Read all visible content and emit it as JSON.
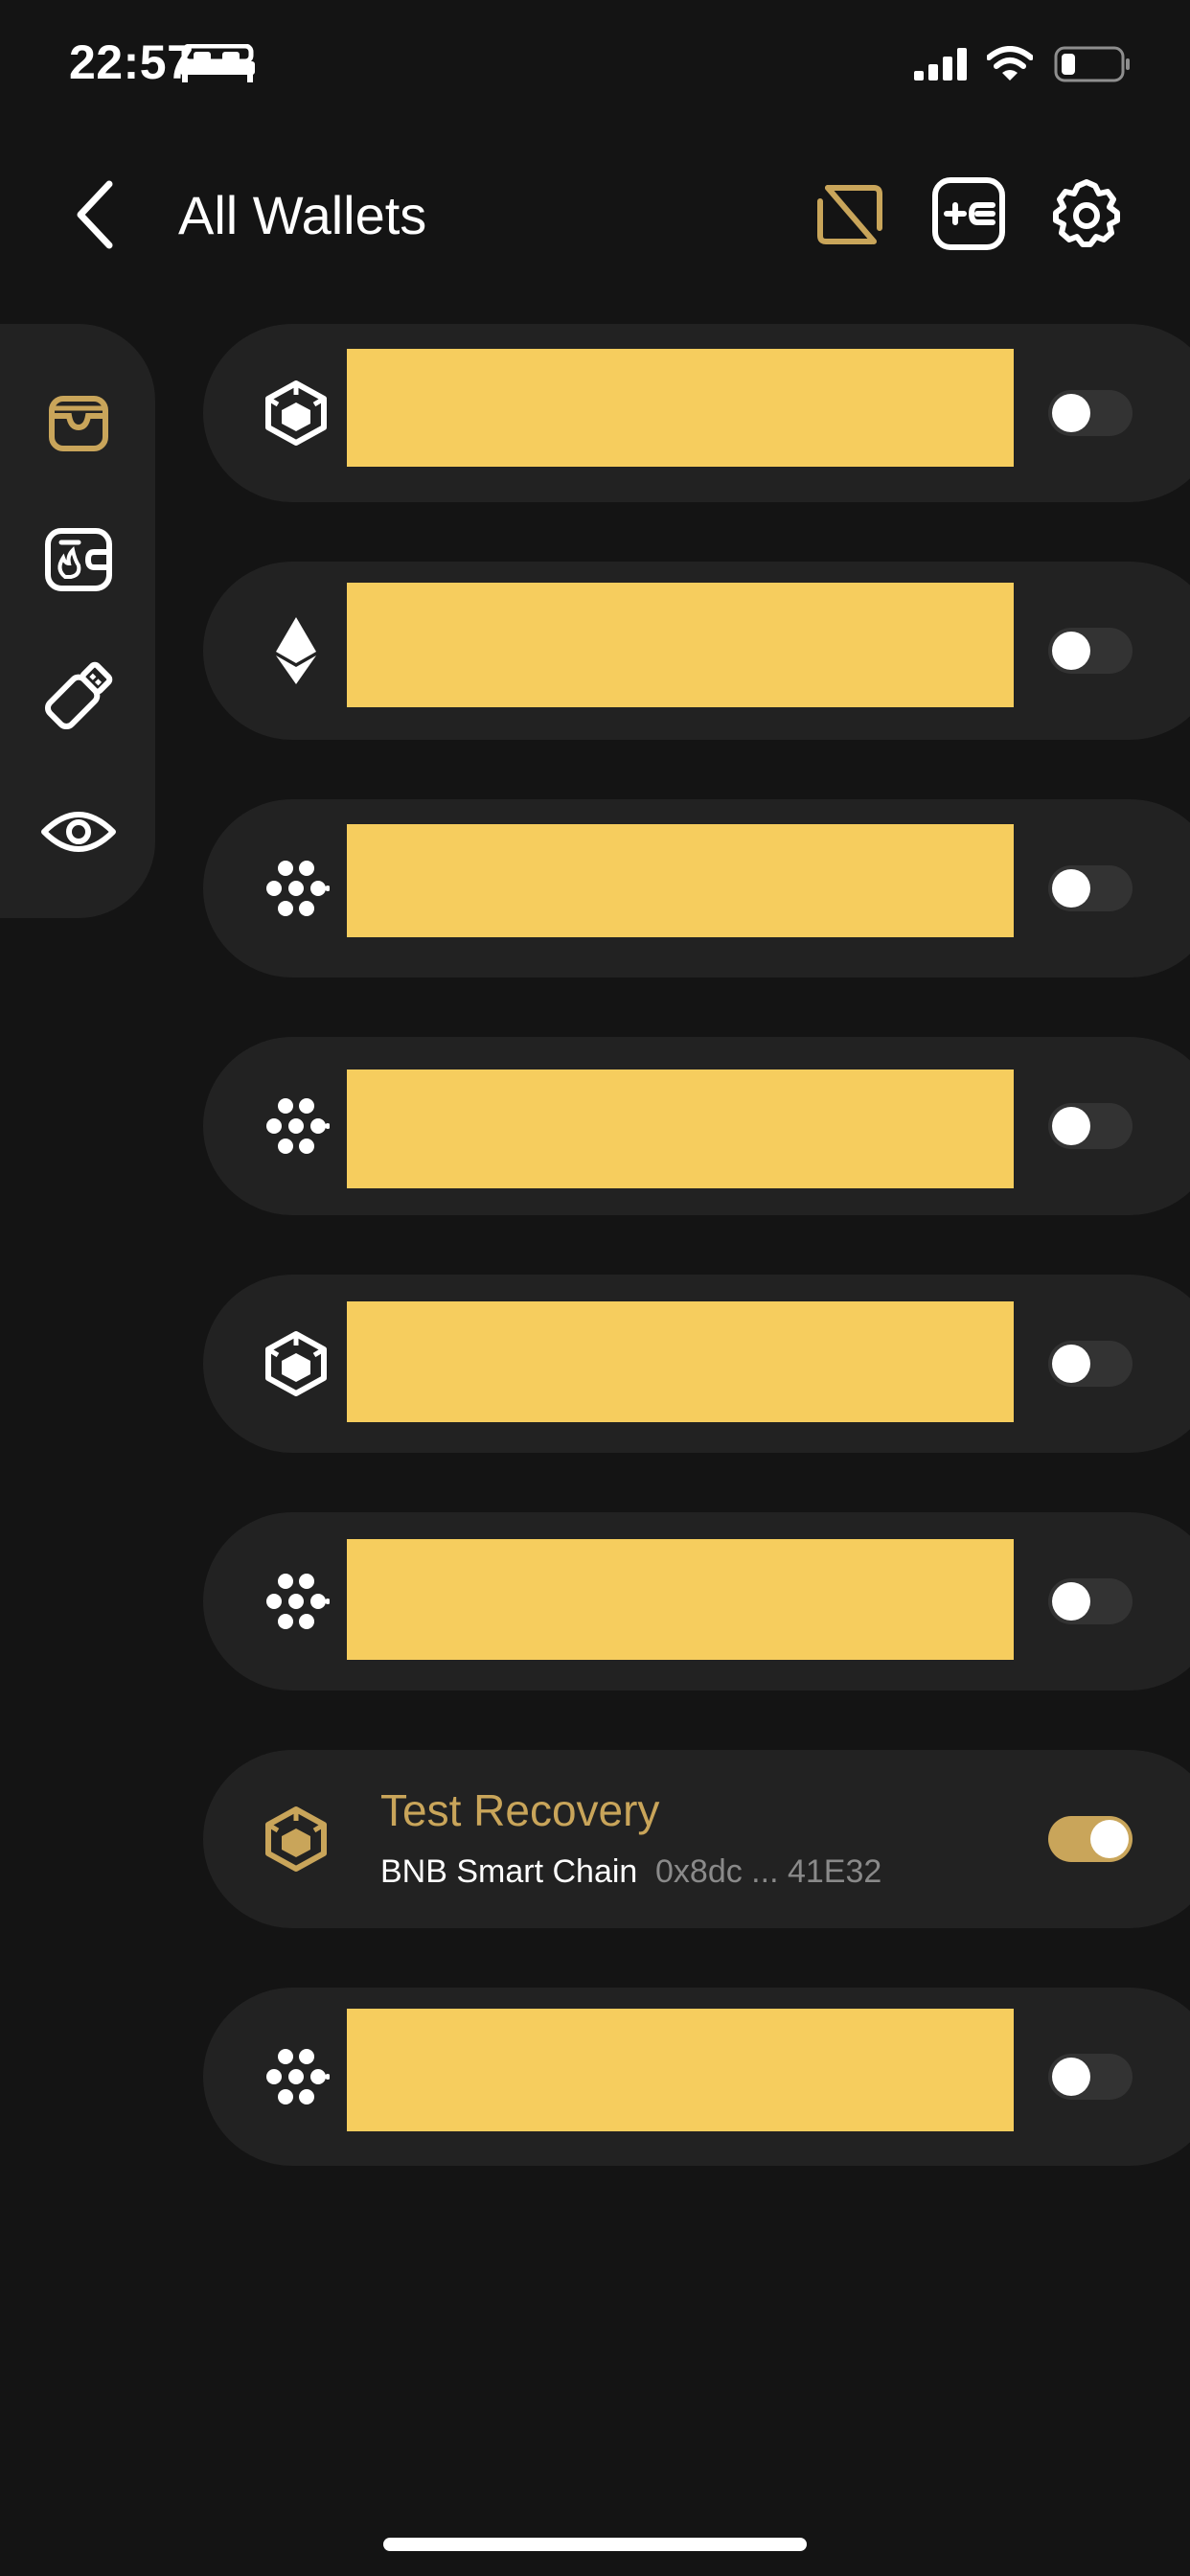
{
  "status_bar": {
    "time": "22:57",
    "icons": [
      "bed-icon",
      "signal-icon",
      "wifi-icon",
      "battery-icon"
    ]
  },
  "header": {
    "title": "All Wallets",
    "icons": [
      "back-chevron-icon",
      "sync-icon",
      "add-card-icon",
      "gear-icon"
    ]
  },
  "sidebar": {
    "items": [
      "wallet-tray-icon",
      "hot-wallet-icon",
      "hardware-key-icon",
      "eye-icon"
    ],
    "active_index": 0
  },
  "wallets": [
    {
      "chain_icon": "bnb-cube-icon",
      "redacted": true,
      "enabled": false
    },
    {
      "chain_icon": "ethereum-icon",
      "redacted": true,
      "enabled": false
    },
    {
      "chain_icon": "hex-dots-icon",
      "redacted": true,
      "enabled": false
    },
    {
      "chain_icon": "hex-dots-icon",
      "redacted": true,
      "enabled": false
    },
    {
      "chain_icon": "bnb-cube-icon",
      "redacted": true,
      "enabled": false
    },
    {
      "chain_icon": "hex-dots-icon",
      "redacted": true,
      "enabled": false
    },
    {
      "chain_icon": "bnb-cube-icon",
      "redacted": false,
      "enabled": true,
      "name": "Test Recovery",
      "chain": "BNB Smart Chain",
      "address": "0x8dc ... 41E32"
    },
    {
      "chain_icon": "hex-dots-icon",
      "redacted": true,
      "enabled": false
    }
  ],
  "colors": {
    "background": "#141414",
    "card": "#222222",
    "accent_gold": "#c9a55a",
    "redaction_yellow": "#f6cd5e",
    "address_gray": "#8a8a8a"
  }
}
